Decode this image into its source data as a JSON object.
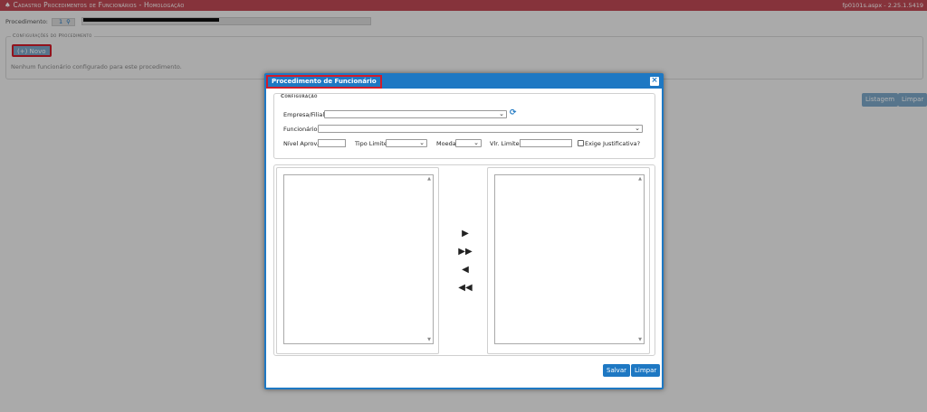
{
  "header": {
    "title": "♠ Cadastro Procedimentos de Funcionários - Homologação",
    "version": "fp0101s.aspx - 2.25.1.5419"
  },
  "procedimento": {
    "label": "Procedimento:",
    "code": "1"
  },
  "config_legend": "Configurações do Procedimento",
  "novo_label": "(+) Novo",
  "empty_message": "Nenhum funcionário configurado para este procedimento.",
  "listagem_label": "Listagem",
  "limpar_bg_label": "Limpar",
  "modal": {
    "title": "Procedimento de Funcionário",
    "close": "×",
    "section_legend": "Configuração",
    "empresa_label": "Empresa/Filial:",
    "funcionario_label": "Funcionário:",
    "nivel_label": "Nível Aprov.:",
    "tipo_limite_label": "Tipo Limite:",
    "moeda_label": "Moeda:",
    "vlr_limite_label": "Vlr. Limite:",
    "exige_label": "Exige Justificativa?",
    "salvar_label": "Salvar",
    "limpar_label": "Limpar"
  },
  "icons": {
    "refresh": "refresh-icon",
    "move_right": "▶",
    "move_all_right": "▶▶",
    "move_left": "◀",
    "move_all_left": "◀◀"
  },
  "colors": {
    "header_bar": "#c04a55",
    "modal_blue": "#1e78c3",
    "highlight_red": "#d11c2a",
    "faded_button": "#7da8c9"
  }
}
